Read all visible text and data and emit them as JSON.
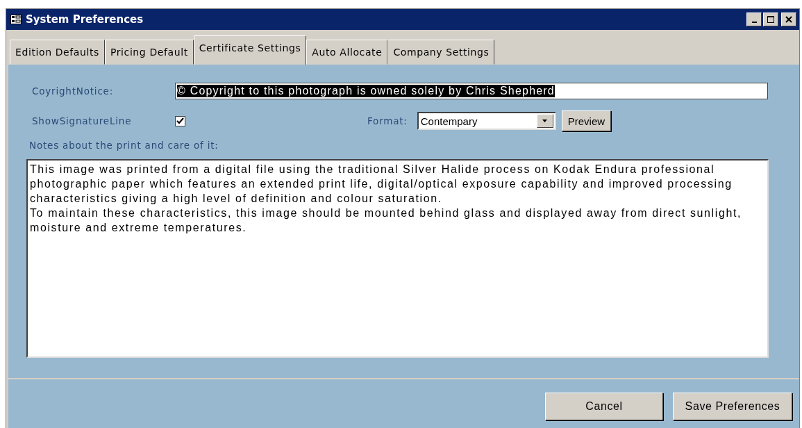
{
  "window": {
    "title": "System Preferences"
  },
  "tabs": [
    {
      "label": "Edition Defaults",
      "selected": false
    },
    {
      "label": "Pricing Default",
      "selected": false
    },
    {
      "label": "Certificate Settings",
      "selected": true
    },
    {
      "label": "Auto Allocate",
      "selected": false
    },
    {
      "label": "Company Settings",
      "selected": false
    }
  ],
  "copyright_notice": {
    "label": "CoyrightNotice:",
    "value": "© Copyright to this photograph is owned solely by Chris Shepherd",
    "selected": true
  },
  "show_signature_line": {
    "label": "ShowSignatureLine",
    "checked": true
  },
  "format": {
    "label": "Format:",
    "value": "Contempary",
    "preview_button": "Preview"
  },
  "notes": {
    "label": "Notes about the print and care of it:",
    "value": "This image was printed from a digital file using the traditional Silver Halide process on Kodak Endura professional photographic paper which features an extended print life, digital/optical exposure capability and improved processing characteristics giving a high level of definition and colour saturation.\nTo maintain these characteristics, this image should be mounted behind glass and displayed away from direct sunlight, moisture and extreme temperatures."
  },
  "buttons": [
    "Cancel",
    "Save Preferences"
  ]
}
